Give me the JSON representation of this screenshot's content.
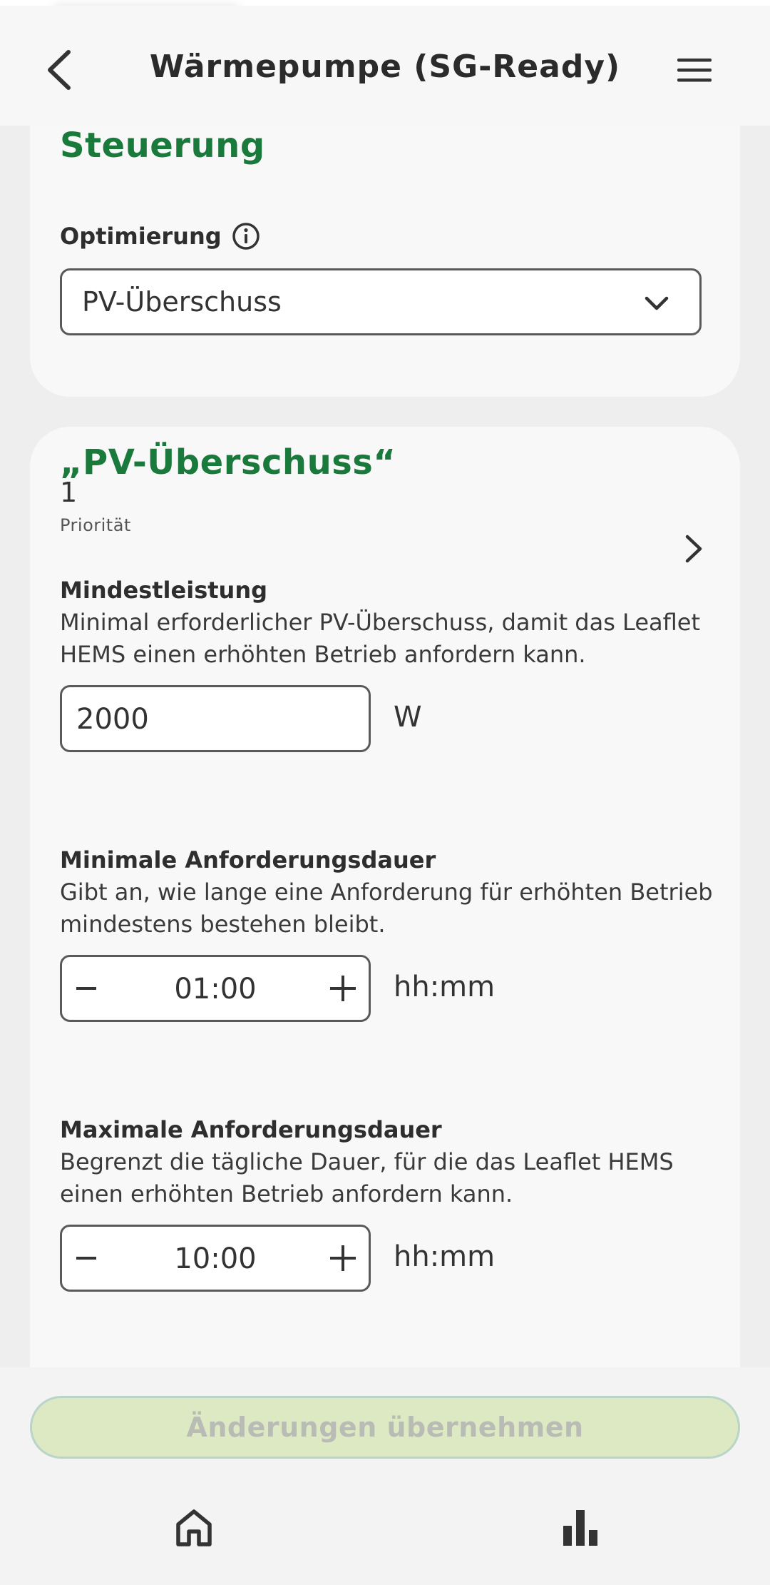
{
  "header": {
    "title": "Wärmepumpe (SG-Ready)"
  },
  "steuerung": {
    "heading": "Steuerung",
    "optimierung_label": "Optimierung",
    "optimierung_value": "PV-Überschuss"
  },
  "pv_section": {
    "heading": "„PV-Überschuss“",
    "priority_value": "1",
    "priority_label": "Priorität",
    "mindestleistung": {
      "label": "Mindestleistung",
      "description": "Minimal erforderlicher PV-Überschuss, damit das Leaflet HEMS einen erhöhten Betrieb  anfordern kann.",
      "value": "2000",
      "unit": "W"
    },
    "min_dauer": {
      "label": "Minimale Anforderungsdauer",
      "description": "Gibt an, wie lange eine Anforderung für erhöhten Betrieb mindestens bestehen bleibt.",
      "value": "01:00",
      "unit": "hh:mm"
    },
    "max_dauer": {
      "label": "Maximale Anforderungsdauer",
      "description": "Begrenzt die tägliche Dauer, für die das Leaflet HEMS einen erhöhten Betrieb anfordern kann.",
      "value": "10:00",
      "unit": "hh:mm"
    }
  },
  "footer": {
    "apply_label": "Änderungen übernehmen"
  },
  "colors": {
    "accent_green": "#1a7a3c",
    "apply_bg_disabled": "#dde9c3"
  },
  "icons": [
    "back-icon",
    "menu-icon",
    "info-icon",
    "chevron-down-icon",
    "chevron-right-icon",
    "minus-icon",
    "plus-icon",
    "home-icon",
    "bar-chart-icon"
  ]
}
